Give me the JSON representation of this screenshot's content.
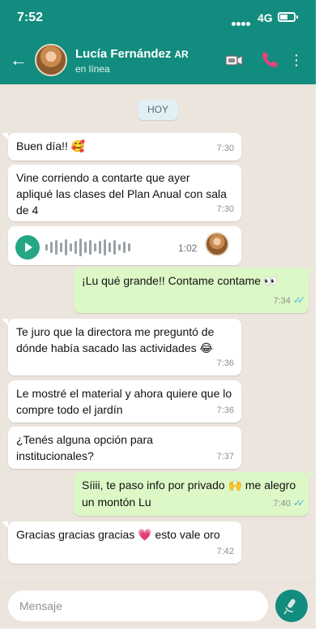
{
  "status_bar": {
    "time": "7:52",
    "network": "4G"
  },
  "header": {
    "contact_name": "Lucía Fernández",
    "contact_flag": "AR",
    "contact_status": "en línea",
    "back_icon": "arrow-left-icon",
    "menu_icon": "more-vertical-icon"
  },
  "chat": {
    "date_label": "HOY",
    "messages": [
      {
        "direction": "in",
        "text": "Buen día!!",
        "emoji": "🥰",
        "time": "7:30"
      },
      {
        "direction": "in",
        "text": "Vine corriendo a contarte que ayer apliqué las clases del Plan Anual con sala de 4",
        "time": "7:30"
      },
      {
        "direction": "in",
        "type": "voice",
        "duration": "1:02"
      },
      {
        "direction": "out",
        "text": "¡Lu qué grande!! Contame contame",
        "emoji": "👀",
        "time": "7:34",
        "read": true
      },
      {
        "direction": "in",
        "text": "Te juro que la directora me preguntó de dónde había sacado las actividades",
        "emoji": "😂",
        "time": "7:36"
      },
      {
        "direction": "in",
        "text": "Le mostré el material y ahora quiere que lo compre todo el jardín",
        "time": "7:36"
      },
      {
        "direction": "in",
        "text": "¿Tenés alguna opción para institucionales?",
        "time": "7:37"
      },
      {
        "direction": "out",
        "text": "Síiii, te paso info por privado",
        "emoji": "🙌",
        "text_after": "me alegro un montón Lu",
        "time": "7:40",
        "read": true
      },
      {
        "direction": "in",
        "text": "Gracias gracias gracias",
        "emoji": "💗",
        "text_after": "esto vale oro",
        "time": "7:42"
      }
    ]
  },
  "input": {
    "placeholder": "Mensaje"
  },
  "colors": {
    "header": "#128c7e",
    "chat_background": "#ece5dd",
    "outgoing_bubble": "#dcf8c6",
    "incoming_bubble": "#ffffff",
    "read_ticks": "#4fb6ec",
    "call_icon": "#e0457b",
    "mic_button": "#128c7e"
  }
}
